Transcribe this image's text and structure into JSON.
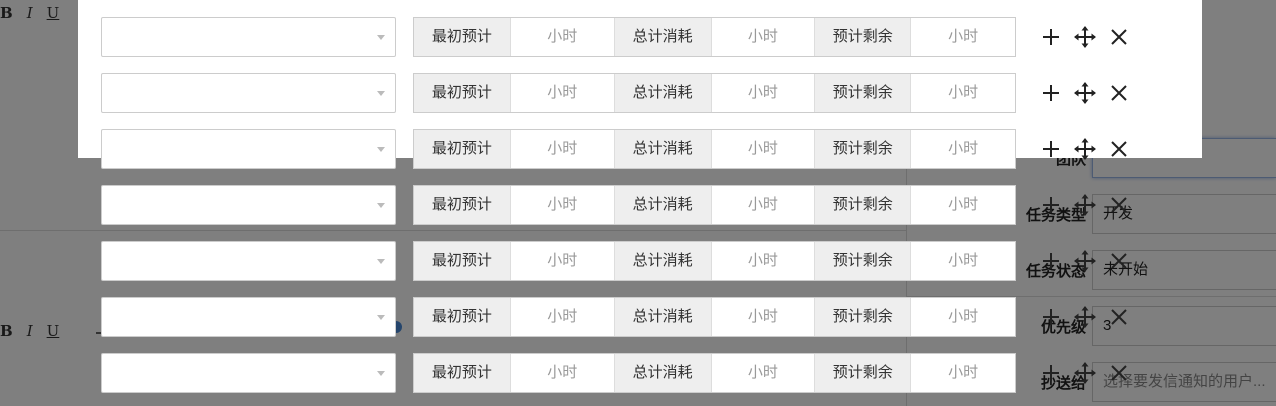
{
  "editor_toolbar": {
    "bold": "B",
    "italic": "I",
    "underline": "U"
  },
  "side_form": {
    "team_label": "团队",
    "task_type_label": "任务类型",
    "task_type_value": "开发",
    "task_status_label": "任务状态",
    "task_status_value": "未开始",
    "priority_label": "优先级",
    "priority_value": "3",
    "cc_label": "抄送给",
    "cc_placeholder": "选择要发信通知的用户..."
  },
  "row_fields": {
    "initial_estimate_label": "最初预计",
    "consumed_label": "总计消耗",
    "remaining_label": "预计剩余",
    "hours_placeholder": "小时"
  },
  "rows": [
    {
      "name": "row-1"
    },
    {
      "name": "row-2"
    },
    {
      "name": "row-3"
    },
    {
      "name": "row-4"
    },
    {
      "name": "row-5"
    },
    {
      "name": "row-6"
    },
    {
      "name": "row-7"
    }
  ],
  "icons": {
    "add": "plus-icon",
    "move": "move-icon",
    "delete": "close-icon",
    "dropdown": "caret-down-icon"
  },
  "colors": {
    "overlay": "rgba(0,0,0,0.5)",
    "label_bg": "#eeeeee",
    "border": "#cccccc",
    "focus": "#9ab6e6"
  }
}
